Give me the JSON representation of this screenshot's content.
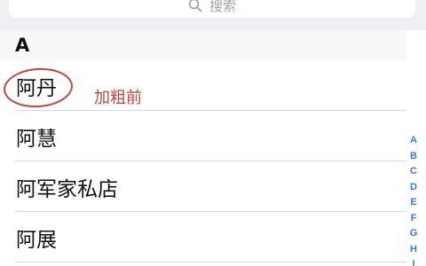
{
  "search": {
    "placeholder": "搜索"
  },
  "section": {
    "letter": "A"
  },
  "contacts": [
    {
      "name": "阿丹"
    },
    {
      "name": "阿慧"
    },
    {
      "name": "阿军家私店"
    },
    {
      "name": "阿展"
    }
  ],
  "annotation": {
    "text": "加粗前"
  },
  "index_letters": [
    "A",
    "B",
    "C",
    "D",
    "E",
    "F",
    "G",
    "H",
    "I"
  ],
  "colors": {
    "annotation": "#c9443b",
    "index": "#3478f6"
  }
}
